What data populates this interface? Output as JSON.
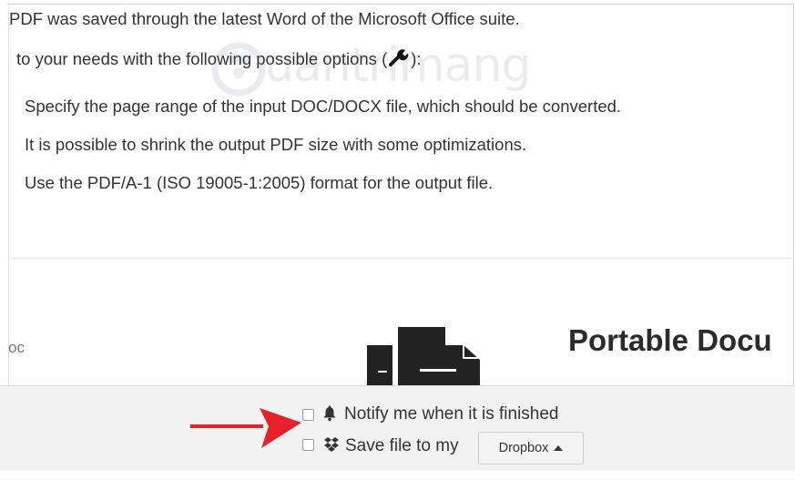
{
  "intro": {
    "line1": "PDF was saved through the latest Word of the Microsoft Office suite.",
    "line2_before": "to your needs with the following possible options (",
    "line2_after": "):",
    "options_icon": "wrench-icon"
  },
  "options": [
    "Specify the page range of the input DOC/DOCX file, which should be converted.",
    "It is possible to shrink the output PDF size with some optimizations.",
    "Use the PDF/A-1 (ISO 19005-1:2005) format for the output file."
  ],
  "watermark": {
    "text": "uantrimang"
  },
  "format_section": {
    "source_label": "oc",
    "target_heading": "Portable Docu"
  },
  "bottom": {
    "notify": {
      "label": "Notify me when it is finished",
      "checked": false,
      "icon": "bell-icon"
    },
    "save": {
      "label": "Save file to my",
      "checked": false,
      "icon": "dropbox-icon"
    },
    "dropbox_button": "Dropbox",
    "arrow_color": "#e8202a"
  }
}
